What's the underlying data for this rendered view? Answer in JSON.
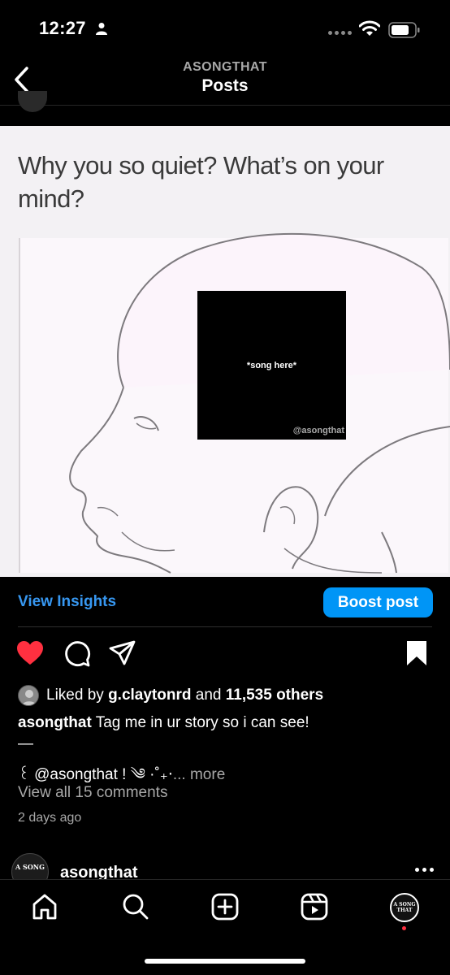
{
  "status_bar": {
    "time": "12:27",
    "icons": [
      "person-icon",
      "signal-icon",
      "wifi-icon",
      "battery-icon"
    ]
  },
  "header": {
    "username": "ASONGTHAT",
    "title": "Posts",
    "back_icon": "chevron-left-icon"
  },
  "post": {
    "image": {
      "caption": "Why you so quiet? What’s on your mind?",
      "box_text": "*song here*",
      "watermark": "@asongthat"
    },
    "view_insights": "View Insights",
    "boost_label": "Boost post",
    "actions": [
      "heart-icon",
      "comment-icon",
      "share-icon",
      "bookmark-icon"
    ],
    "liked": true,
    "likes": {
      "prefix": "Liked by",
      "user": "g.claytonrd",
      "connector": "and",
      "others": "11,535 others"
    },
    "caption": {
      "username": "asongthat",
      "text": "Tag me in ur story so i can see!",
      "dash": "—",
      "line2": "꒰ @asongthat ! ༄ ·˚₊‧",
      "more": "... more"
    },
    "comments_link": "View all 15 comments",
    "timestamp": "2 days ago"
  },
  "next_post": {
    "avatar_text": "A SONG",
    "username": "asongthat"
  },
  "tab_bar": {
    "tabs": [
      "home-icon",
      "search-icon",
      "create-icon",
      "reels-icon",
      "profile-avatar"
    ],
    "profile_avatar_text": "A SONG THAT"
  },
  "colors": {
    "accent": "#0095f6",
    "link": "#3797f0",
    "like": "#ff3040",
    "secondary_text": "#a8a8a8"
  }
}
